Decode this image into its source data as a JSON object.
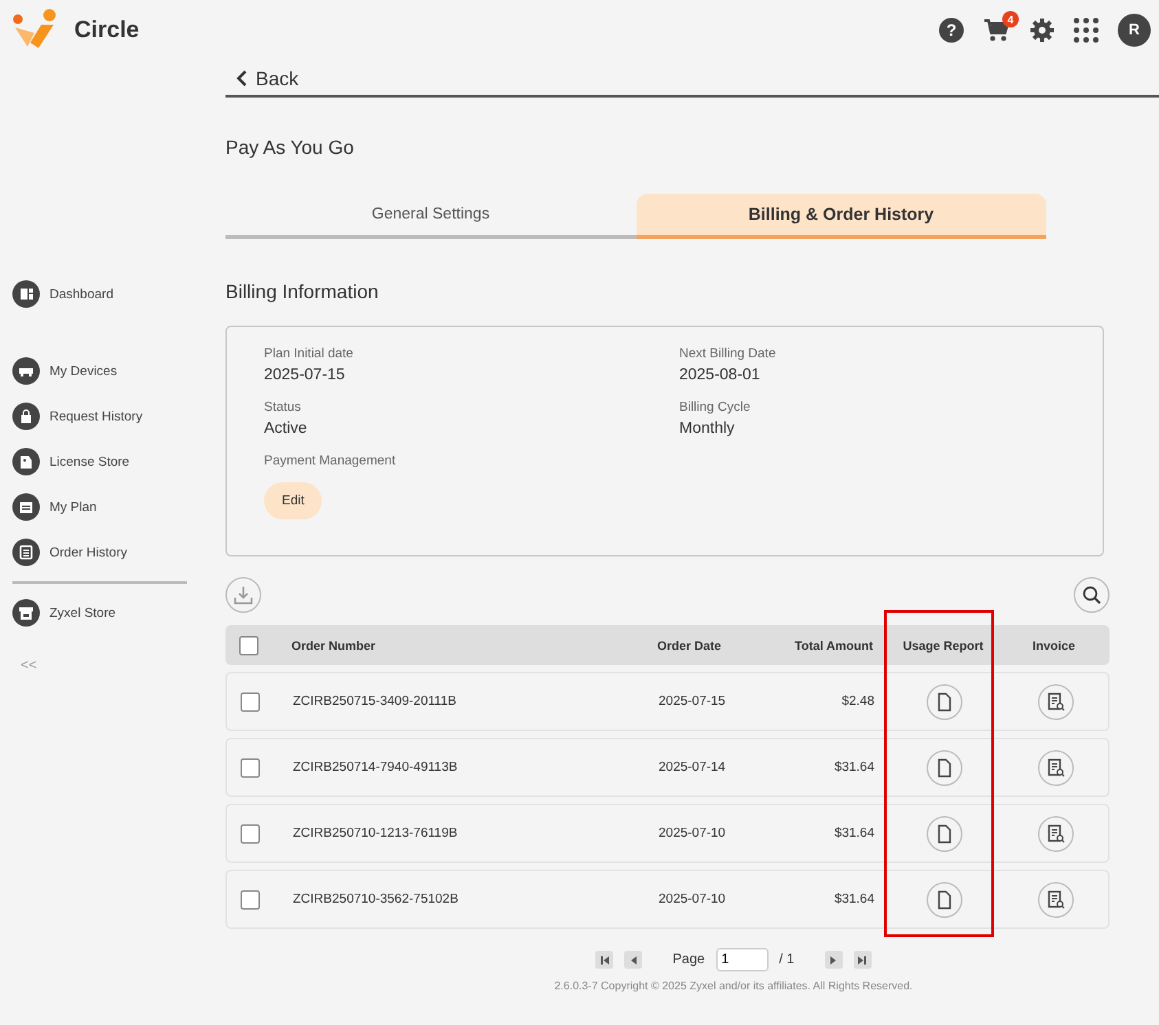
{
  "app": {
    "name": "Circle"
  },
  "header": {
    "help": "?",
    "cart_count": "4",
    "avatar": "R"
  },
  "sidebar": {
    "sections": [
      {
        "divider_before": false,
        "items": [
          "Dashboard"
        ]
      },
      {
        "divider_before": false,
        "items": [
          "My Devices",
          "Request History",
          "License Store",
          "My Plan",
          "Order History"
        ]
      },
      {
        "divider_before": true,
        "items": [
          "Zyxel Store"
        ]
      }
    ],
    "collapse": "<<"
  },
  "back": "Back",
  "title": "Pay As You Go",
  "tabs": [
    {
      "label": "General Settings",
      "selected": false
    },
    {
      "label": "Billing & Order History",
      "selected": true
    }
  ],
  "section_title": "Billing Information",
  "billing_fields": [
    {
      "label": "Plan Initial date",
      "value": "2025-07-15"
    },
    {
      "label": "Next Billing Date",
      "value": "2025-08-01"
    },
    {
      "label": "Status",
      "value": "Active"
    },
    {
      "label": "Billing Cycle",
      "value": "Monthly"
    }
  ],
  "payment": {
    "label": "Payment Management",
    "button": "Edit"
  },
  "table": {
    "header_checked": false,
    "columns": [
      {
        "label": "Order Number",
        "highlighted": false
      },
      {
        "label": "Order Date",
        "highlighted": false
      },
      {
        "label": "Total Amount",
        "highlighted": false
      },
      {
        "label": "Usage Report",
        "highlighted": true
      },
      {
        "label": "Invoice",
        "highlighted": false
      }
    ],
    "rows": [
      {
        "checked": false,
        "order_number": "ZCIRB250715-3409-20111B",
        "order_date": "2025-07-15",
        "total_amount": "$2.48"
      },
      {
        "checked": false,
        "order_number": "ZCIRB250714-7940-49113B",
        "order_date": "2025-07-14",
        "total_amount": "$31.64"
      },
      {
        "checked": false,
        "order_number": "ZCIRB250710-1213-76119B",
        "order_date": "2025-07-10",
        "total_amount": "$31.64"
      },
      {
        "checked": false,
        "order_number": "ZCIRB250710-3562-75102B",
        "order_date": "2025-07-10",
        "total_amount": "$31.64"
      }
    ]
  },
  "pagination": {
    "label": "Page",
    "value": "1",
    "total": "/ 1"
  },
  "footer": "2.6.0.3-7 Copyright © 2025 Zyxel and/or its affiliates. All Rights Reserved."
}
